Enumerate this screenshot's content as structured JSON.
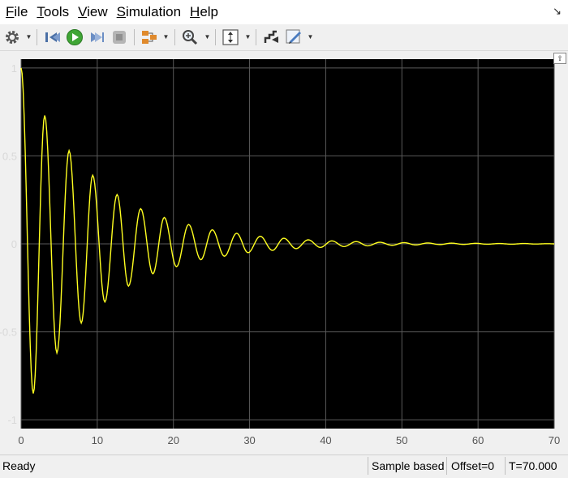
{
  "menu": {
    "items": [
      {
        "id": "file",
        "key": "F",
        "rest": "ile"
      },
      {
        "id": "tools",
        "key": "T",
        "rest": "ools"
      },
      {
        "id": "view",
        "key": "V",
        "rest": "iew"
      },
      {
        "id": "simulation",
        "key": "S",
        "rest": "imulation"
      },
      {
        "id": "help",
        "key": "H",
        "rest": "elp"
      }
    ]
  },
  "toolbar": {
    "icons": [
      "gear-icon",
      "step-back-icon",
      "run-icon",
      "step-forward-icon",
      "stop-icon",
      "layout-icon",
      "zoom-icon",
      "scale-icon",
      "highlight-icon",
      "edit-icon"
    ]
  },
  "colors": {
    "plot_background": "#000000",
    "grid": "#5a5a5a",
    "signal": "#ffff20",
    "axis_text": "#d8d8d8"
  },
  "chart_data": {
    "type": "line",
    "xlim": [
      0,
      70
    ],
    "ylim": [
      -1.05,
      1.05
    ],
    "xticks": [
      0,
      10,
      20,
      30,
      40,
      50,
      60,
      70
    ],
    "yticks": [
      1,
      0.5,
      0,
      -0.5,
      -1
    ],
    "ytick_labels": [
      "1",
      "0.5",
      "0",
      "-0.5",
      "-1"
    ],
    "grid": true,
    "series": [
      {
        "color": "#ffff20",
        "x": [
          0,
          1.6,
          3.1,
          4.7,
          6.3,
          7.9,
          9.4,
          11,
          12.6,
          14.1,
          15.7,
          17.3,
          18.8,
          20.4,
          22,
          23.6,
          25.1,
          26.7,
          28.3,
          29.8,
          31.4,
          33,
          34.5,
          36.1,
          37.7,
          39.3,
          40.8,
          42.4,
          44,
          45.5,
          47.1,
          48.7,
          50.3,
          51.8,
          53.4,
          55,
          56.5,
          58.1,
          59.7,
          61.2,
          62.8,
          64.4,
          66,
          67.5,
          69.1,
          70
        ],
        "y": [
          1,
          -0.85,
          0.73,
          -0.62,
          0.53,
          -0.45,
          0.39,
          -0.33,
          0.28,
          -0.24,
          0.2,
          -0.17,
          0.15,
          -0.13,
          0.11,
          -0.09,
          0.08,
          -0.07,
          0.06,
          -0.05,
          0.043,
          -0.037,
          0.032,
          -0.027,
          0.023,
          -0.02,
          0.017,
          -0.015,
          0.013,
          -0.011,
          0.009,
          -0.008,
          0.007,
          -0.006,
          0.005,
          -0.004,
          0.004,
          -0.003,
          0.003,
          -0.002,
          0.002,
          -0.002,
          0.002,
          -0.001,
          0.001,
          0
        ]
      }
    ]
  },
  "status": {
    "ready": "Ready",
    "mode": "Sample based",
    "offset": "Offset=0",
    "time": "T=70.000"
  }
}
